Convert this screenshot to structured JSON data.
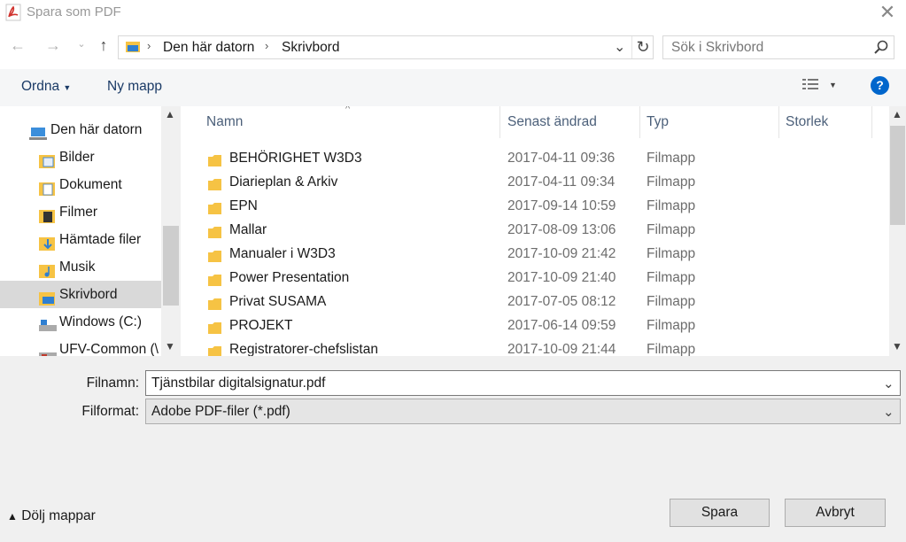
{
  "window": {
    "title": "Spara som PDF"
  },
  "nav": {
    "breadcrumb": [
      "Den här datorn",
      "Skrivbord"
    ],
    "search_placeholder": "Sök i Skrivbord"
  },
  "toolbar": {
    "organize": "Ordna",
    "new_folder": "Ny mapp",
    "help": "?"
  },
  "sidebar": {
    "items": [
      {
        "label": "Den här datorn",
        "icon": "computer-icon"
      },
      {
        "label": "Bilder",
        "icon": "pictures-folder-icon"
      },
      {
        "label": "Dokument",
        "icon": "documents-folder-icon"
      },
      {
        "label": "Filmer",
        "icon": "videos-folder-icon"
      },
      {
        "label": "Hämtade filer",
        "icon": "downloads-folder-icon"
      },
      {
        "label": "Musik",
        "icon": "music-folder-icon"
      },
      {
        "label": "Skrivbord",
        "icon": "desktop-folder-icon",
        "selected": true
      },
      {
        "label": "Windows (C:)",
        "icon": "drive-icon"
      },
      {
        "label": "UFV-Common (\\",
        "icon": "network-drive-icon"
      }
    ]
  },
  "columns": {
    "name": "Namn",
    "modified": "Senast ändrad",
    "type": "Typ",
    "size": "Storlek"
  },
  "files": [
    {
      "name": "BEHÖRIGHET W3D3",
      "modified": "2017-04-11 09:36",
      "type": "Filmapp"
    },
    {
      "name": "Diarieplan & Arkiv",
      "modified": "2017-04-11 09:34",
      "type": "Filmapp"
    },
    {
      "name": "EPN",
      "modified": "2017-09-14 10:59",
      "type": "Filmapp"
    },
    {
      "name": "Mallar",
      "modified": "2017-08-09 13:06",
      "type": "Filmapp"
    },
    {
      "name": "Manualer i W3D3",
      "modified": "2017-10-09 21:42",
      "type": "Filmapp"
    },
    {
      "name": "Power Presentation",
      "modified": "2017-10-09 21:40",
      "type": "Filmapp"
    },
    {
      "name": "Privat SUSAMA",
      "modified": "2017-07-05 08:12",
      "type": "Filmapp"
    },
    {
      "name": "PROJEKT",
      "modified": "2017-06-14 09:59",
      "type": "Filmapp"
    },
    {
      "name": "Registratorer-chefslistan",
      "modified": "2017-10-09 21:44",
      "type": "Filmapp"
    }
  ],
  "form": {
    "filename_label": "Filnamn:",
    "filename_value": "Tjänstbilar digitalsignatur.pdf",
    "format_label": "Filformat:",
    "format_value": "Adobe PDF-filer (*.pdf)"
  },
  "footer": {
    "hide_folders": "Dölj mappar",
    "save": "Spara",
    "cancel": "Avbryt"
  },
  "colors": {
    "accent": "#0066cc",
    "folder": "#f6c344",
    "selected": "#d9d9d9"
  }
}
